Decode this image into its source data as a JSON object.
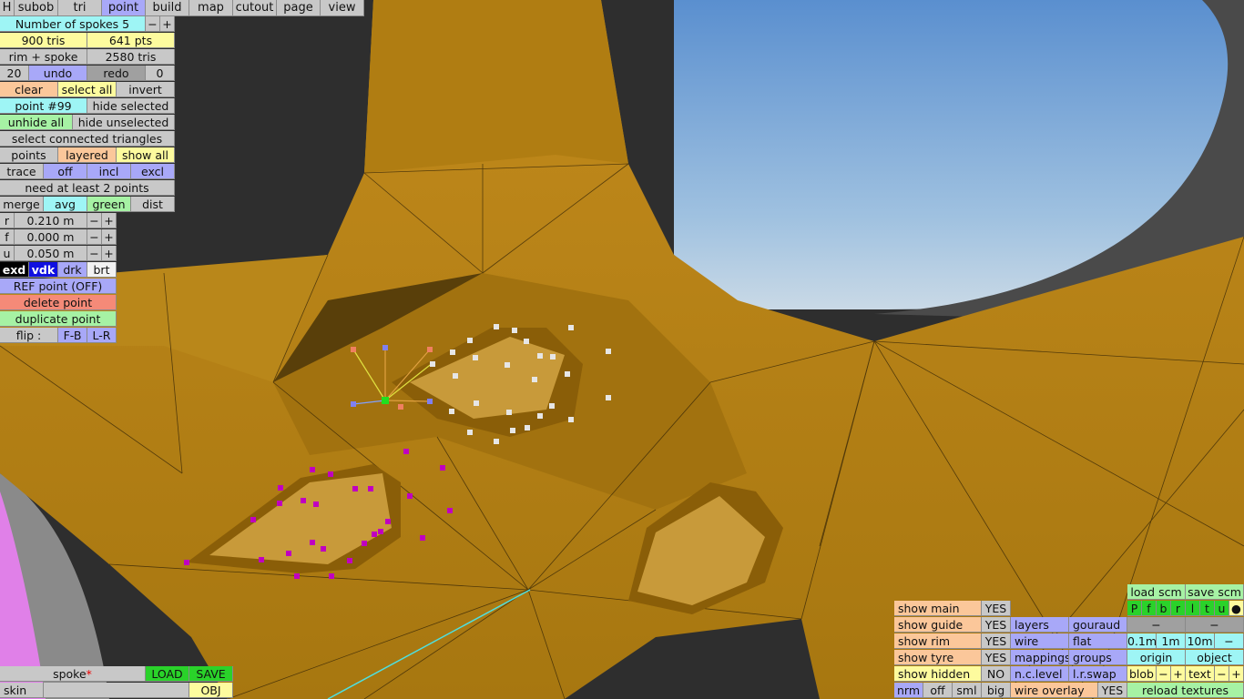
{
  "menu": [
    "H",
    "subob",
    "tri",
    "point",
    "build",
    "map",
    "cutout",
    "page",
    "view"
  ],
  "left": {
    "spokes_label": "Number of spokes 5",
    "minus": "−",
    "plus": "+",
    "tris": "900 tris",
    "pts": "641 pts",
    "rim_spoke": "rim + spoke",
    "rim_tris": "2580 tris",
    "undo_count": "20",
    "undo": "undo",
    "redo": "redo",
    "redo_count": "0",
    "clear": "clear",
    "select_all": "select all",
    "invert": "invert",
    "point_no": "point #99",
    "hide_selected": "hide selected",
    "unhide_all": "unhide all",
    "hide_unselected": "hide unselected",
    "select_connected": "select connected triangles",
    "points": "points",
    "layered": "layered",
    "show_all": "show all",
    "trace": "trace",
    "off": "off",
    "incl": "incl",
    "excl": "excl",
    "need_points": "need at least 2 points",
    "merge": "merge",
    "avg": "avg",
    "green": "green",
    "dist": "dist",
    "r_label": "r",
    "r_val": "0.210 m",
    "f_label": "f",
    "f_val": "0.000 m",
    "u_label": "u",
    "u_val": "0.050 m",
    "exd": "exd",
    "vdk": "vdk",
    "drk": "drk",
    "brt": "brt",
    "ref_point": "REF point (OFF)",
    "delete_point": "delete point",
    "duplicate_point": "duplicate point",
    "flip": "flip :",
    "fb": "F-B",
    "lr": "L-R"
  },
  "bottom_left": {
    "spoke": "spoke",
    "asterisk": "*",
    "load": "LOAD",
    "save": "SAVE",
    "skin": "skin",
    "obj": "OBJ"
  },
  "right": {
    "show_main": "show main",
    "show_main_val": "YES",
    "show_guide": "show guide",
    "show_guide_val": "YES",
    "show_rim": "show rim",
    "show_rim_val": "YES",
    "show_tyre": "show tyre",
    "show_tyre_val": "YES",
    "show_hidden": "show hidden",
    "show_hidden_val": "NO",
    "nrm": "nrm",
    "off": "off",
    "sml": "sml",
    "big": "big",
    "layers": "layers",
    "gouraud": "gouraud",
    "wire": "wire",
    "flat": "flat",
    "mappings": "mappings",
    "groups": "groups",
    "nc_level": "n.c.level",
    "lr_swap": "l.r.swap",
    "wire_overlay": "wire overlay",
    "wire_overlay_val": "YES",
    "load_scm": "load scm",
    "save_scm": "save scm",
    "letters": [
      "P",
      "f",
      "b",
      "r",
      "l",
      "t",
      "u",
      "●"
    ],
    "dash": "−",
    "d01": "0.1m",
    "d1": "1m",
    "d10": "10m",
    "origin": "origin",
    "object": "object",
    "blob": "blob",
    "text": "text",
    "reload": "reload textures"
  },
  "colors": {
    "sky": "#8fb8dc",
    "mesh": "#b8860b",
    "selected_points": "#c000c0",
    "unselected_points": "#e8e8e8"
  }
}
